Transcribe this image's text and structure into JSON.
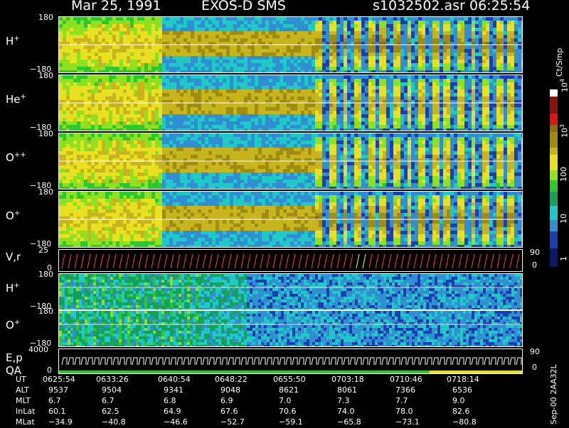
{
  "header": {
    "date": "Mar 25, 1991",
    "mission": "EXOS-D SMS",
    "file": "s1032502.asr",
    "time": "06:25:54"
  },
  "colors": {
    "palette": [
      "#0a1a6b",
      "#1a3fb0",
      "#2f8fd0",
      "#20c8c8",
      "#16a05a",
      "#2ec82e",
      "#8fe020",
      "#e8e020",
      "#c8b41e",
      "#a08c10",
      "#8c6e0e",
      "#e01414",
      "#8b1010",
      "#ffffff"
    ]
  },
  "chart_data": {
    "type": "heatmap",
    "panels": [
      {
        "label": "H",
        "sup": "+",
        "ymax": "180",
        "ymin": "−180"
      },
      {
        "label": "He",
        "sup": "+",
        "ymax": "180",
        "ymin": "−180"
      },
      {
        "label": "O",
        "sup": "++",
        "ymax": "180",
        "ymin": "−180"
      },
      {
        "label": "O",
        "sup": "+",
        "ymax": "180",
        "ymin": "−180"
      },
      {
        "label": "V,r",
        "sup": "",
        "ymax": "25",
        "ymin": "0",
        "rmax": "90",
        "rmin": "0"
      },
      {
        "label": "H",
        "sup": "+",
        "ymax": "180",
        "ymin": "−180"
      },
      {
        "label": "O",
        "sup": "+",
        "ymax": "180",
        "ymin": "−180"
      },
      {
        "label": "E,p",
        "sup": "",
        "label2": "QA",
        "ymax": "4000",
        "ymin": "0",
        "rmax": "90",
        "rmin": "0"
      }
    ],
    "colorbar": {
      "unit": "Ct/Smp",
      "ticks": [
        "10",
        "4",
        "10",
        "3",
        "100",
        "10",
        "1"
      ]
    },
    "table": {
      "rows": [
        {
          "name": "UT",
          "values": [
            "0625:54",
            "0633:26",
            "0640:54",
            "0648:22",
            "0655:50",
            "0703:18",
            "0710:46",
            "0718:14"
          ]
        },
        {
          "name": "ALT",
          "values": [
            "9537",
            "9504",
            "9341",
            "9048",
            "8621",
            "8061",
            "7366",
            "6536"
          ]
        },
        {
          "name": "MLT",
          "values": [
            "6.7",
            "6.7",
            "6.8",
            "6.9",
            "7.0",
            "7.3",
            "7.7",
            "9.0"
          ]
        },
        {
          "name": "InLat",
          "values": [
            "60.1",
            "62.5",
            "64.9",
            "67.6",
            "70.6",
            "74.0",
            "78.0",
            "82.6"
          ]
        },
        {
          "name": "MLat",
          "values": [
            "−34.9",
            "−40.8",
            "−46.6",
            "−52.7",
            "−59.1",
            "−65.8",
            "−73.1",
            "−80.8"
          ]
        }
      ]
    }
  },
  "footer": {
    "side_text": "Sep-00 2AA32L"
  }
}
